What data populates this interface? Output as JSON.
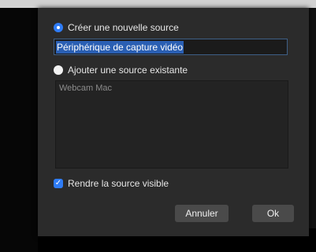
{
  "dialog": {
    "new_source": {
      "label": "Créer une nouvelle source",
      "selected": true
    },
    "name_field": {
      "value": "Périphérique de capture vidéo"
    },
    "existing_source": {
      "label": "Ajouter une source existante",
      "selected": false
    },
    "existing_list": {
      "items": [
        "Webcam Mac"
      ]
    },
    "visible_checkbox": {
      "label": "Rendre la source visible",
      "checked": true
    },
    "buttons": {
      "cancel_label": "Annuler",
      "ok_label": "Ok"
    }
  },
  "colors": {
    "accent": "#2f7cf6",
    "selection": "#2a5fb3",
    "dialog_bg": "#2b2b2b",
    "button_bg": "#4a4a4a"
  },
  "icons": {
    "checkbox": "check-mark-icon"
  }
}
